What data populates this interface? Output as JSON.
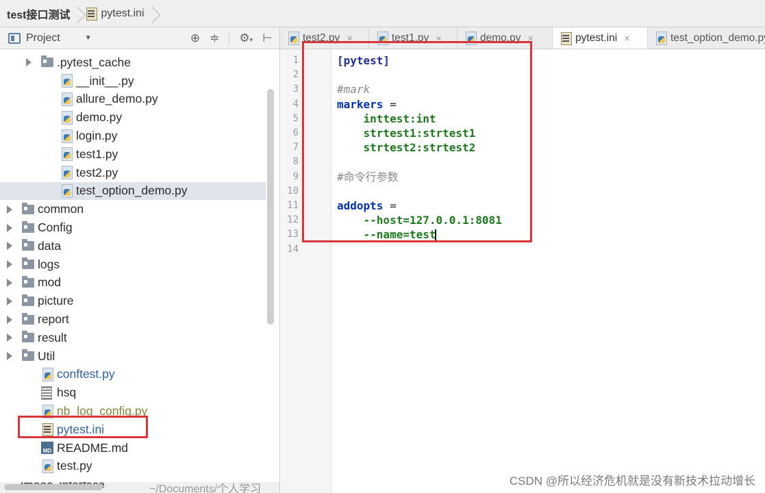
{
  "breadcrumb": {
    "project": "test接口测试",
    "file": "pytest.ini"
  },
  "left_panel": {
    "title": "Project",
    "tools": [
      "target-icon",
      "collapse-icon",
      "gear-icon",
      "hide-panel-icon"
    ]
  },
  "tree": [
    {
      "name": ".pytest_cache",
      "type": "folder",
      "indent": 60,
      "expandable": true
    },
    {
      "name": "__init__.py",
      "type": "py",
      "indent": 88
    },
    {
      "name": "allure_demo.py",
      "type": "py",
      "indent": 88
    },
    {
      "name": "demo.py",
      "type": "py",
      "indent": 88
    },
    {
      "name": "login.py",
      "type": "py",
      "indent": 88
    },
    {
      "name": "test1.py",
      "type": "py",
      "indent": 88
    },
    {
      "name": "test2.py",
      "type": "py",
      "indent": 88
    },
    {
      "name": "test_option_demo.py",
      "type": "py",
      "indent": 88,
      "selected": true
    },
    {
      "name": "common",
      "type": "folder",
      "indent": 32,
      "expandable": true
    },
    {
      "name": "Config",
      "type": "folder",
      "indent": 32,
      "expandable": true
    },
    {
      "name": "data",
      "type": "folder",
      "indent": 32,
      "expandable": true
    },
    {
      "name": "logs",
      "type": "folder",
      "indent": 32,
      "expandable": true
    },
    {
      "name": "mod",
      "type": "folder",
      "indent": 32,
      "expandable": true
    },
    {
      "name": "picture",
      "type": "folder",
      "indent": 32,
      "expandable": true
    },
    {
      "name": "report",
      "type": "folder",
      "indent": 32,
      "expandable": true
    },
    {
      "name": "result",
      "type": "folder",
      "indent": 32,
      "expandable": true
    },
    {
      "name": "Util",
      "type": "folder",
      "indent": 32,
      "expandable": true
    },
    {
      "name": "conftest.py",
      "type": "py",
      "indent": 60,
      "color": "blue"
    },
    {
      "name": "hsq",
      "type": "txt",
      "indent": 60
    },
    {
      "name": "nb_log_config.py",
      "type": "py",
      "indent": 60,
      "color": "olive"
    },
    {
      "name": "pytest.ini",
      "type": "ini",
      "indent": 60,
      "color": "blue"
    },
    {
      "name": "README.md",
      "type": "md",
      "indent": 60
    },
    {
      "name": "test.py",
      "type": "py",
      "indent": 60
    }
  ],
  "bottom_row": {
    "name": "imooc_interface",
    "path": "~/Documents/个人学习"
  },
  "tabs": [
    {
      "label": "test2.py",
      "icon": "py"
    },
    {
      "label": "test1.py",
      "icon": "py"
    },
    {
      "label": "demo.py",
      "icon": "py"
    },
    {
      "label": "pytest.ini",
      "icon": "ini",
      "active": true
    },
    {
      "label": "test_option_demo.py",
      "icon": "py"
    }
  ],
  "code_lines": [
    [
      {
        "t": "[pytest]",
        "c": "sec"
      }
    ],
    [],
    [
      {
        "t": "#mark",
        "c": "cmt"
      }
    ],
    [
      {
        "t": "markers",
        "c": "key"
      },
      {
        "t": " =",
        "c": "eq"
      }
    ],
    [
      {
        "t": "    inttest:int",
        "c": "val"
      }
    ],
    [
      {
        "t": "    strtest1:strtest1",
        "c": "val"
      }
    ],
    [
      {
        "t": "    strtest2:strtest2",
        "c": "val"
      }
    ],
    [],
    [
      {
        "t": "#命令行参数",
        "c": "cmt-plain"
      }
    ],
    [],
    [
      {
        "t": "addopts",
        "c": "key"
      },
      {
        "t": " =",
        "c": "eq"
      }
    ],
    [
      {
        "t": "    --host=127.0.0.1:8081",
        "c": "val"
      }
    ],
    [
      {
        "t": "    --name=test",
        "c": "val",
        "caret": true
      }
    ],
    []
  ],
  "watermark": "CSDN @所以经济危机就是没有新技术拉动增长"
}
